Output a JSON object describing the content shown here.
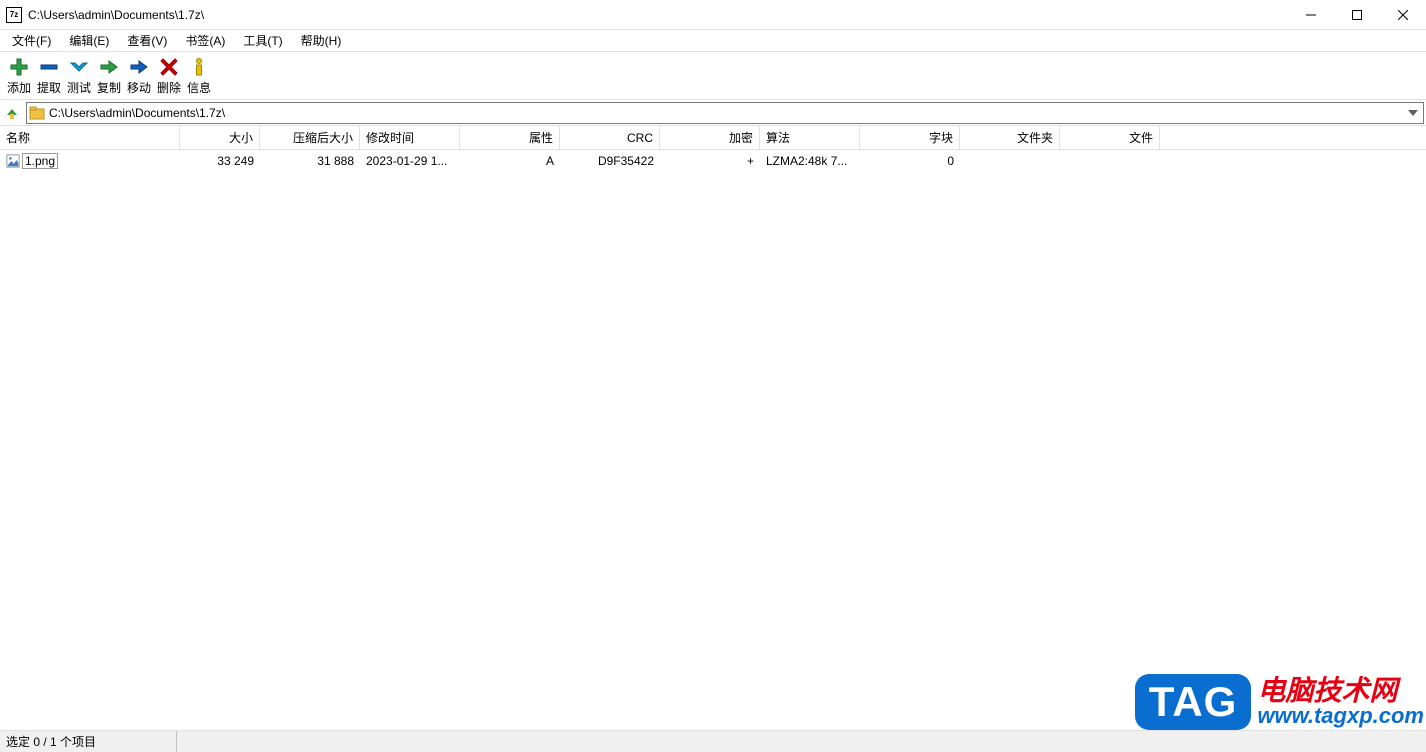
{
  "window": {
    "title": "C:\\Users\\admin\\Documents\\1.7z\\",
    "icon_label": "7z"
  },
  "menubar": {
    "items": [
      "文件(F)",
      "编辑(E)",
      "查看(V)",
      "书签(A)",
      "工具(T)",
      "帮助(H)"
    ]
  },
  "toolbar": {
    "buttons": [
      {
        "name": "add",
        "label": "添加",
        "icon": "plus-green"
      },
      {
        "name": "extract",
        "label": "提取",
        "icon": "minus-blue"
      },
      {
        "name": "test",
        "label": "测试",
        "icon": "check-blue"
      },
      {
        "name": "copy",
        "label": "复制",
        "icon": "arrow-right-green"
      },
      {
        "name": "move",
        "label": "移动",
        "icon": "arrow-right-blue"
      },
      {
        "name": "delete",
        "label": "删除",
        "icon": "x-red"
      },
      {
        "name": "info",
        "label": "信息",
        "icon": "info-yellow"
      }
    ]
  },
  "addressbar": {
    "path": "C:\\Users\\admin\\Documents\\1.7z\\"
  },
  "columns": {
    "name": "名称",
    "size": "大小",
    "packed": "压缩后大小",
    "modified": "修改时间",
    "attr": "属性",
    "crc": "CRC",
    "encrypted": "加密",
    "method": "算法",
    "block": "字块",
    "folders": "文件夹",
    "files": "文件"
  },
  "rows": [
    {
      "name": "1.png",
      "size": "33 249",
      "packed": "31 888",
      "modified": "2023-01-29 1...",
      "attr": "A",
      "crc": "D9F35422",
      "encrypted": "+",
      "method": "LZMA2:48k 7...",
      "block": "0",
      "folders": "",
      "files": ""
    }
  ],
  "statusbar": {
    "selection": "选定 0 / 1 个项目"
  },
  "watermark": {
    "tag": "TAG",
    "cn": "电脑技术网",
    "url": "www.tagxp.com"
  }
}
